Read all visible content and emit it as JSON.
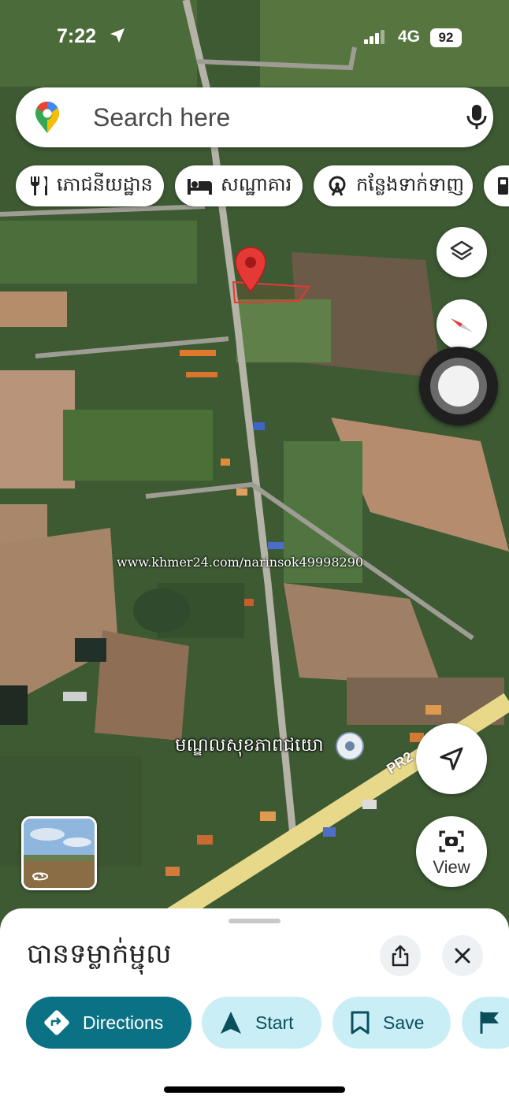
{
  "status": {
    "time": "7:22",
    "network": "4G",
    "battery": "92"
  },
  "search": {
    "placeholder": "Search here"
  },
  "chips": [
    {
      "label": "ភោជនីយដ្ឋាន",
      "icon": "restaurant-icon"
    },
    {
      "label": "សណ្ឋាគារ",
      "icon": "hotel-icon"
    },
    {
      "label": "កន្លែងទាក់ទាញ",
      "icon": "attraction-icon"
    },
    {
      "label": "",
      "icon": "gas-station-icon"
    }
  ],
  "map": {
    "watermark": "www.khmer24.com/narinsok49998290",
    "poi_label": "មណ្ឌលសុខភាពជយោ",
    "road_label": "PR2"
  },
  "view_button": {
    "label": "View"
  },
  "sheet": {
    "title": "បានទម្លាក់ម្ជុល",
    "actions": [
      {
        "label": "Directions",
        "icon": "directions-icon"
      },
      {
        "label": "Start",
        "icon": "navigation-arrow-icon"
      },
      {
        "label": "Save",
        "icon": "bookmark-icon"
      },
      {
        "label": "",
        "icon": "flag-icon"
      }
    ]
  },
  "colors": {
    "accent_dark": "#0b7285",
    "accent_light": "#c9eef6",
    "pin_red": "#e53935",
    "road_yellow": "#e8d88a"
  }
}
